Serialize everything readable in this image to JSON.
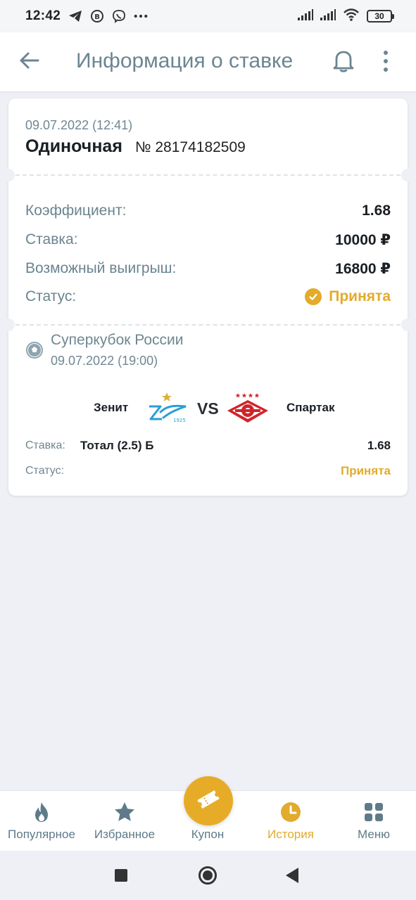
{
  "status_bar": {
    "time": "12:42",
    "battery": "30",
    "icons": [
      "telegram-icon",
      "b-circle-icon",
      "viber-icon",
      "more-dots-icon",
      "signal-icon",
      "signal-icon",
      "wifi-icon",
      "battery-icon"
    ]
  },
  "header": {
    "title": "Информация о ставке",
    "icons": [
      "back-arrow-icon",
      "bell-icon",
      "more-vertical-icon"
    ]
  },
  "bet": {
    "date": "09.07.2022 (12:41)",
    "type": "Одиночная",
    "number": "№ 28174182509",
    "rows": {
      "coef_label": "Коэффициент:",
      "coef_value": "1.68",
      "stake_label": "Ставка:",
      "stake_value": "10000 ₽",
      "win_label": "Возможный выигрыш:",
      "win_value": "16800 ₽",
      "status_label": "Статус:",
      "status_value": "Принята"
    }
  },
  "event": {
    "league": "Суперкубок России",
    "date": "09.07.2022 (19:00)",
    "team1": "Зенит",
    "vs": "VS",
    "team2": "Спартак",
    "stake_label": "Ставка:",
    "stake_value": "Тотал (2.5) Б",
    "odds": "1.68",
    "status_label": "Статус:",
    "status_value": "Принята"
  },
  "bottom_nav": {
    "items": [
      {
        "label": "Популярное",
        "icon": "fire-icon"
      },
      {
        "label": "Избранное",
        "icon": "star-icon"
      },
      {
        "label": "Купон",
        "icon": "ticket-icon"
      },
      {
        "label": "История",
        "icon": "clock-icon",
        "active": true
      },
      {
        "label": "Меню",
        "icon": "grid-icon"
      }
    ]
  },
  "colors": {
    "accent": "#e2ab2b",
    "muted_text": "#6f8792",
    "title": "#6b8592",
    "background": "#eef0f5"
  }
}
